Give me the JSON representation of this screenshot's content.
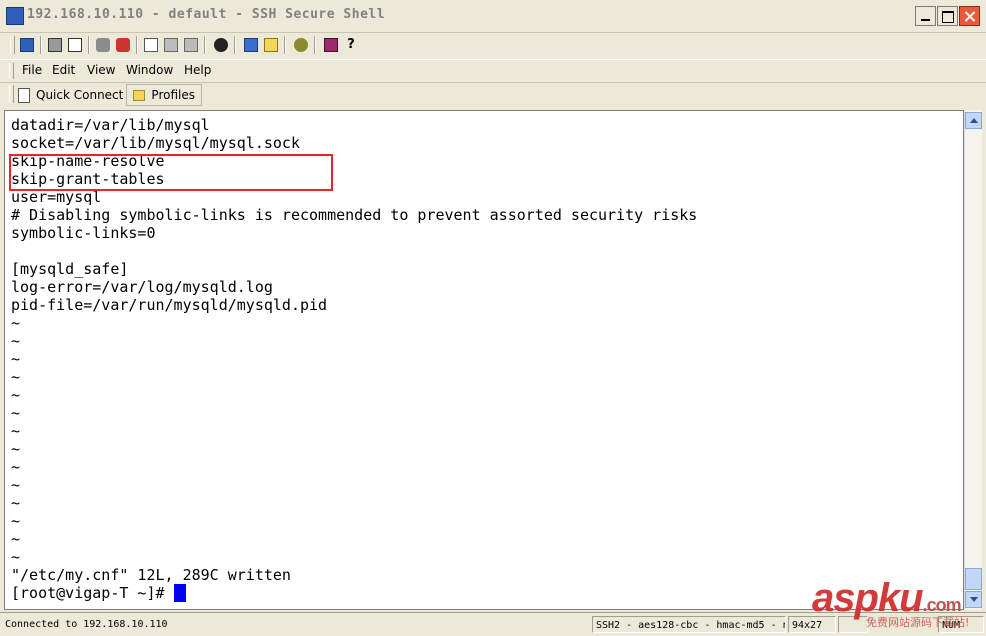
{
  "window": {
    "title": "192.168.10.110 - default - SSH Secure Shell",
    "controls": {
      "minimize": "minimize-button",
      "maximize": "maximize-button",
      "close": "close-button"
    }
  },
  "toolbar": {
    "icons": [
      "save-icon",
      "print-icon",
      "print-preview-icon",
      "connect-icon",
      "disconnect-icon",
      "copy-icon",
      "paste-icon",
      "paste-alt-icon",
      "find-icon",
      "new-terminal-icon",
      "new-file-transfer-icon",
      "settings-icon",
      "help-book-icon",
      "context-help-icon"
    ],
    "colors": {
      "accent": "#2f5fb8",
      "icon_yellow": "#f5d45a",
      "icon_gray": "#6a6a6a"
    }
  },
  "menu": {
    "items": [
      "File",
      "Edit",
      "View",
      "Window",
      "Help"
    ]
  },
  "quickbar": {
    "quick_connect": "Quick Connect",
    "profiles": "Profiles"
  },
  "terminal": {
    "lines": [
      "datadir=/var/lib/mysql",
      "socket=/var/lib/mysql/mysql.sock",
      "skip-name-resolve",
      "skip-grant-tables",
      "user=mysql",
      "# Disabling symbolic-links is recommended to prevent assorted security risks",
      "symbolic-links=0",
      "",
      "[mysqld_safe]",
      "log-error=/var/log/mysqld.log",
      "pid-file=/var/run/mysqld/mysqld.pid",
      "~",
      "~",
      "~",
      "~",
      "~",
      "~",
      "~",
      "~",
      "~",
      "~",
      "~",
      "~",
      "~",
      "~",
      "\"/etc/my.cnf\" 12L, 289C written",
      "[root@vigap-T ~]# "
    ],
    "highlight_color": "#e8262a",
    "cursor_color": "#0000ff"
  },
  "status": {
    "connection": "Connected to 192.168.10.110",
    "cipher": "SSH2 - aes128-cbc - hmac-md5 - n",
    "size": "94x27",
    "extra": "NUM"
  },
  "watermark": {
    "brand": "aspku",
    "tld": ".com",
    "subtitle": "免费网站源码下载站!"
  }
}
